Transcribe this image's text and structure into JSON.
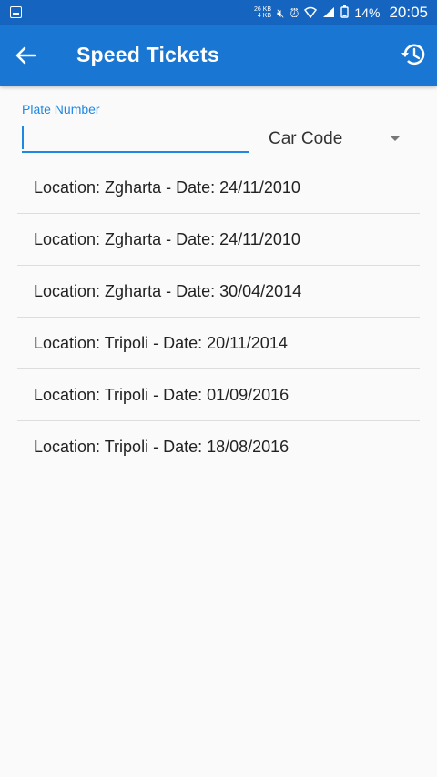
{
  "status_bar": {
    "net_up": "26 KB",
    "net_down": "4 KB",
    "battery": "14%",
    "time": "20:05",
    "icons": [
      "gallery-icon",
      "mute-icon",
      "alarm-icon",
      "wifi-icon",
      "signal-icon",
      "battery-icon"
    ]
  },
  "app_bar": {
    "title": "Speed Tickets",
    "back_icon": "arrow-left-icon",
    "history_icon": "history-icon",
    "background": "#1976d2"
  },
  "form": {
    "plate_label": "Plate Number",
    "plate_value": "",
    "car_code_label": "Car Code"
  },
  "tickets": [
    "Location: Zgharta - Date: 24/11/2010",
    "Location: Zgharta - Date: 24/11/2010",
    "Location: Zgharta - Date: 30/04/2014",
    "Location: Tripoli - Date: 20/11/2014",
    "Location: Tripoli - Date: 01/09/2016",
    "Location: Tripoli - Date: 18/08/2016"
  ],
  "colors": {
    "accent": "#1e88e5",
    "status_bar": "#1565c0"
  }
}
